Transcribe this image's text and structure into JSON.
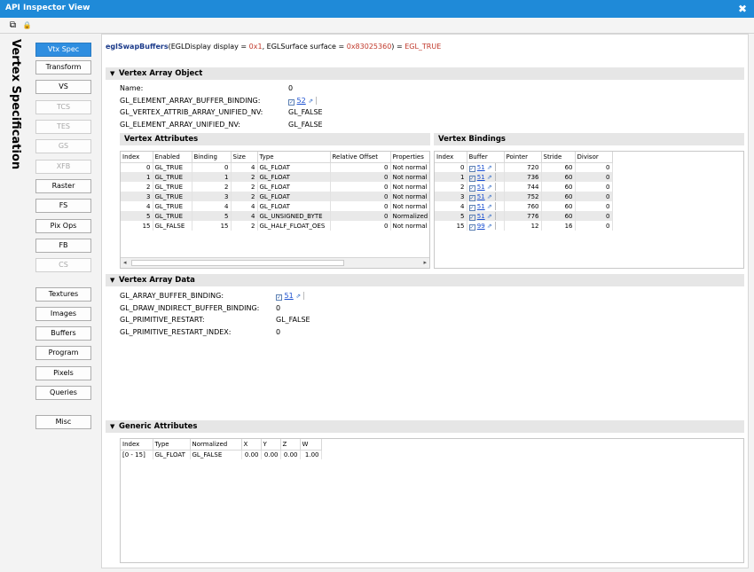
{
  "window": {
    "title": "API Inspector View",
    "close_glyph": "✖"
  },
  "toolbar": {
    "copy_icon": "⧉",
    "lock_icon": "🔒"
  },
  "sidebar": {
    "vertical_label": "Vertex Specification",
    "buttons": [
      {
        "label": "Vtx Spec",
        "state": "active"
      },
      {
        "label": "Transform",
        "state": "normal"
      },
      {
        "label": "VS",
        "state": "normal"
      },
      {
        "label": "TCS",
        "state": "disabled"
      },
      {
        "label": "TES",
        "state": "disabled"
      },
      {
        "label": "GS",
        "state": "disabled"
      },
      {
        "label": "XFB",
        "state": "disabled"
      },
      {
        "label": "Raster",
        "state": "normal"
      },
      {
        "label": "FS",
        "state": "normal"
      },
      {
        "label": "Pix Ops",
        "state": "normal"
      },
      {
        "label": "FB",
        "state": "normal"
      },
      {
        "label": "CS",
        "state": "disabled"
      },
      {
        "label": "Textures",
        "state": "normal"
      },
      {
        "label": "Images",
        "state": "normal"
      },
      {
        "label": "Buffers",
        "state": "normal"
      },
      {
        "label": "Program",
        "state": "normal"
      },
      {
        "label": "Pixels",
        "state": "normal"
      },
      {
        "label": "Queries",
        "state": "normal"
      },
      {
        "label": "Misc",
        "state": "normal"
      }
    ]
  },
  "call": {
    "fn": "eglSwapBuffers",
    "p1": "(EGLDisplay display = ",
    "v1": "0x1",
    "p2": ", EGLSurface surface = ",
    "v2": "0x83025360",
    "p3": ") = ",
    "ret": "EGL_TRUE"
  },
  "vao": {
    "header": "Vertex Array Object",
    "props": [
      {
        "key": "Name:",
        "value": "0"
      },
      {
        "key": "GL_ELEMENT_ARRAY_BUFFER_BINDING:",
        "value": "52"
      },
      {
        "key": "GL_VERTEX_ATTRIB_ARRAY_UNIFIED_NV:",
        "value": "GL_FALSE"
      },
      {
        "key": "GL_ELEMENT_ARRAY_UNIFIED_NV:",
        "value": "GL_FALSE"
      }
    ]
  },
  "vertex_attributes": {
    "header": "Vertex Attributes",
    "columns": [
      "Index",
      "Enabled",
      "Binding",
      "Size",
      "Type",
      "Relative Offset",
      "Properties"
    ],
    "rows": [
      [
        "0",
        "GL_TRUE",
        "0",
        "4",
        "GL_FLOAT",
        "0",
        "Not normal"
      ],
      [
        "1",
        "GL_TRUE",
        "1",
        "2",
        "GL_FLOAT",
        "0",
        "Not normal"
      ],
      [
        "2",
        "GL_TRUE",
        "2",
        "2",
        "GL_FLOAT",
        "0",
        "Not normal"
      ],
      [
        "3",
        "GL_TRUE",
        "3",
        "2",
        "GL_FLOAT",
        "0",
        "Not normal"
      ],
      [
        "4",
        "GL_TRUE",
        "4",
        "4",
        "GL_FLOAT",
        "0",
        "Not normal"
      ],
      [
        "5",
        "GL_TRUE",
        "5",
        "4",
        "GL_UNSIGNED_BYTE",
        "0",
        "Normalized"
      ],
      [
        "15",
        "GL_FALSE",
        "15",
        "2",
        "GL_HALF_FLOAT_OES",
        "0",
        "Not normal"
      ]
    ],
    "scroll_left": "◂",
    "scroll_right": "▸"
  },
  "vertex_bindings": {
    "header": "Vertex Bindings",
    "columns": [
      "Index",
      "Buffer",
      "Pointer",
      "Stride",
      "Divisor"
    ],
    "rows": [
      [
        "0",
        "51",
        "720",
        "60",
        "0"
      ],
      [
        "1",
        "51",
        "736",
        "60",
        "0"
      ],
      [
        "2",
        "51",
        "744",
        "60",
        "0"
      ],
      [
        "3",
        "51",
        "752",
        "60",
        "0"
      ],
      [
        "4",
        "51",
        "760",
        "60",
        "0"
      ],
      [
        "5",
        "51",
        "776",
        "60",
        "0"
      ],
      [
        "15",
        "99",
        "12",
        "16",
        "0"
      ]
    ]
  },
  "vad": {
    "header": "Vertex Array Data",
    "props": [
      {
        "key": "GL_ARRAY_BUFFER_BINDING:",
        "value": "51"
      },
      {
        "key": "GL_DRAW_INDIRECT_BUFFER_BINDING:",
        "value": "0"
      },
      {
        "key": "GL_PRIMITIVE_RESTART:",
        "value": "GL_FALSE"
      },
      {
        "key": "GL_PRIMITIVE_RESTART_INDEX:",
        "value": "0"
      }
    ]
  },
  "generic": {
    "header": "Generic Attributes",
    "columns": [
      "Index",
      "Type",
      "Normalized",
      "X",
      "Y",
      "Z",
      "W"
    ],
    "rows": [
      [
        "[0 - 15]",
        "GL_FLOAT",
        "GL_FALSE",
        "0.00",
        "0.00",
        "0.00",
        "1.00"
      ]
    ]
  },
  "glyphs": {
    "expand_arrow": "▼",
    "buffer_check": "✓",
    "buffer_pin": "⇗"
  }
}
